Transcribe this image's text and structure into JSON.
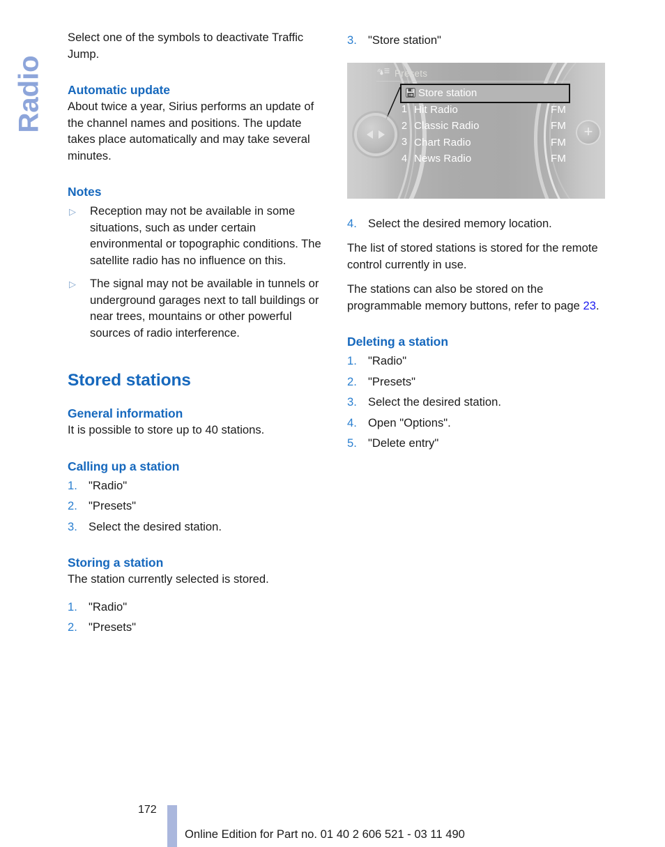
{
  "chapter_tab": {
    "label": "Radio"
  },
  "left_column": {
    "intro_paragraph": "Select one of the symbols to deactivate Traffic Jump.",
    "automatic_update": {
      "heading": "Automatic update",
      "paragraph": "About twice a year, Sirius performs an update of the channel names and positions. The update takes place automatically and may take several minutes."
    },
    "notes": {
      "heading": "Notes",
      "bullet_marker": "▷",
      "items": [
        "Reception may not be available in some situations, such as under certain environmental or topographic conditions. The satellite radio has no influence on this.",
        "The signal may not be available in tunnels or underground garages next to tall buildings or near trees, mountains or other powerful sources of radio interference."
      ]
    },
    "stored_stations": {
      "heading": "Stored stations",
      "general_information": {
        "heading": "General information",
        "paragraph": "It is possible to store up to 40 stations."
      },
      "calling_up_a_station": {
        "heading": "Calling up a station",
        "steps": [
          {
            "marker": "1.",
            "text": "\"Radio\""
          },
          {
            "marker": "2.",
            "text": "\"Presets\""
          },
          {
            "marker": "3.",
            "text": "Select the desired station."
          }
        ]
      },
      "storing_a_station": {
        "heading": "Storing a station",
        "paragraph": "The station currently selected is stored.",
        "steps": [
          {
            "marker": "1.",
            "text": "\"Radio\""
          },
          {
            "marker": "2.",
            "text": "\"Presets\""
          }
        ]
      }
    }
  },
  "right_column": {
    "step3": {
      "marker": "3.",
      "text": "\"Store station\""
    },
    "idrive_screen": {
      "header_icon": "satellite-radio-icon",
      "header_title": "Presets",
      "selected_row": {
        "icon": "save-icon",
        "label": "Store station"
      },
      "rows": [
        {
          "num": "1",
          "name": "Hit Radio",
          "band": "FM"
        },
        {
          "num": "2",
          "name": "Classic Radio",
          "band": "FM"
        },
        {
          "num": "3",
          "name": "Chart Radio",
          "band": "FM"
        },
        {
          "num": "4",
          "name": "News Radio",
          "band": "FM"
        }
      ],
      "controller": {
        "left_arrow": "◀",
        "right_arrow": "▶"
      },
      "plus_button": "+"
    },
    "step4": {
      "marker": "4.",
      "text": "Select the desired memory location."
    },
    "paragraph_remote": "The list of stored stations is stored for the remote control currently in use.",
    "paragraph_memory_buttons_pre": "The stations can also be stored on the programmable memory buttons, refer to page ",
    "paragraph_memory_buttons_ref": "23",
    "paragraph_memory_buttons_post": ".",
    "deleting_a_station": {
      "heading": "Deleting a station",
      "steps": [
        {
          "marker": "1.",
          "text": "\"Radio\""
        },
        {
          "marker": "2.",
          "text": "\"Presets\""
        },
        {
          "marker": "3.",
          "text": "Select the desired station."
        },
        {
          "marker": "4.",
          "text": "Open \"Options\"."
        },
        {
          "marker": "5.",
          "text": "\"Delete entry\""
        }
      ]
    }
  },
  "footer": {
    "page_number": "172",
    "edition_text": "Online Edition for Part no. 01 40 2 606 521 - 03 11 490"
  },
  "colors": {
    "heading_blue": "#1668bd",
    "marker_blue": "#2a7fd0",
    "tab_blue": "#8da5da",
    "link_blue": "#1b1bf0",
    "footer_bar": "#aab7dd"
  }
}
